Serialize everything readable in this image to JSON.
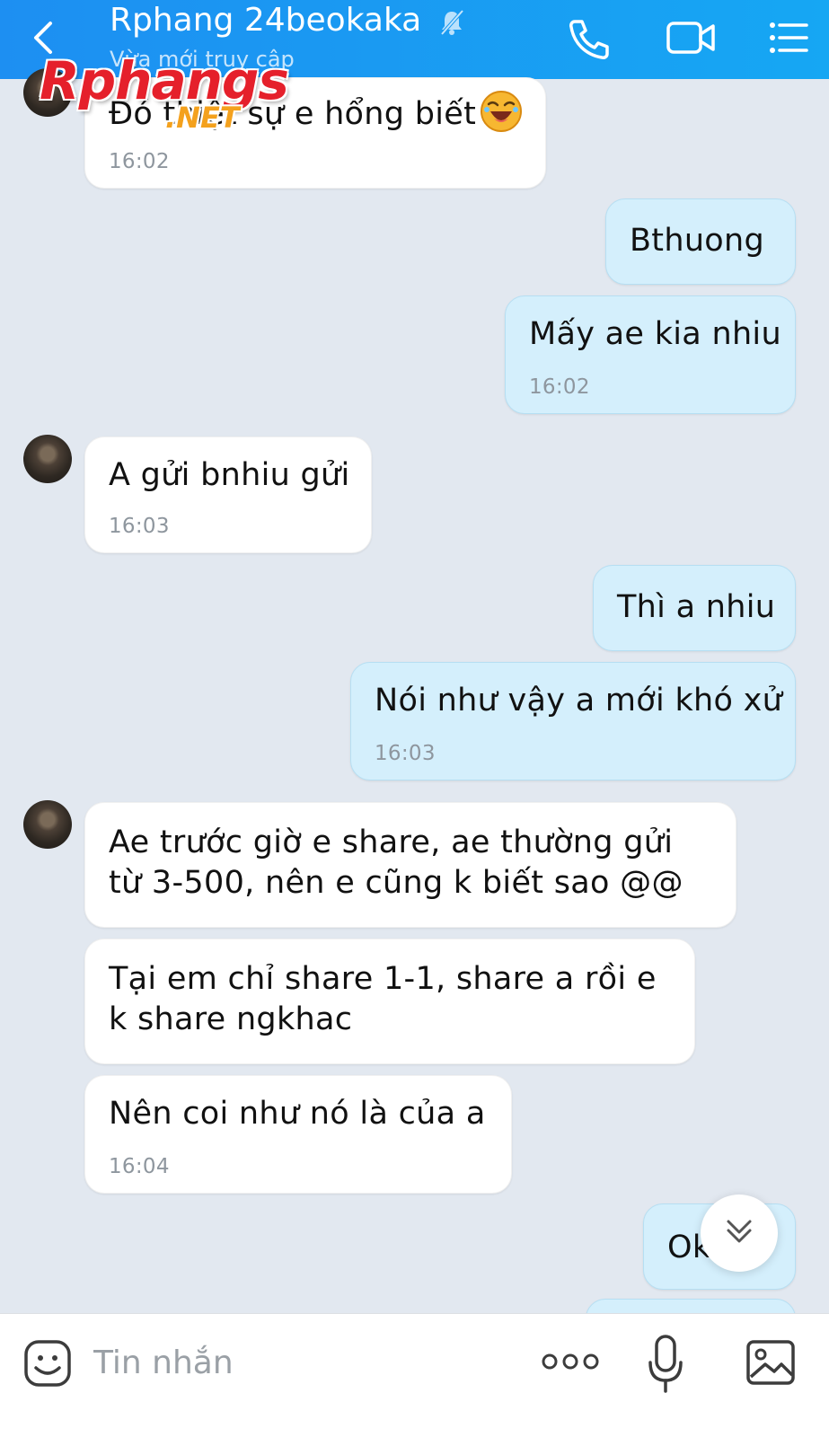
{
  "header": {
    "title": "Rphang 24beokaka",
    "status": "Vừa mới truy cập",
    "icons": [
      "back-icon",
      "mute-icon",
      "phone-icon",
      "video-icon",
      "menu-icon"
    ]
  },
  "watermark": {
    "main": "Rphangs",
    "sub": ".NET"
  },
  "messages": [
    {
      "from": "contact",
      "text": "Đó thiệt sự e hổng biết",
      "emoji": "laughing-emoji",
      "time": "16:02"
    },
    {
      "from": "me",
      "text": "Bthuong",
      "time": ""
    },
    {
      "from": "me",
      "text": "Mấy ae kia nhiu",
      "time": "16:02"
    },
    {
      "from": "contact",
      "text": "A gửi bnhiu gửi",
      "time": "16:03"
    },
    {
      "from": "me",
      "text": "Thì a nhiu",
      "time": ""
    },
    {
      "from": "me",
      "text": "Nói như vậy a mới khó xử",
      "time": "16:03"
    },
    {
      "from": "contact",
      "text": "Ae trước giờ e share, ae thường gửi từ 3-500, nên e cũng k biết sao @@",
      "time": ""
    },
    {
      "from": "contact",
      "text": "Tại em chỉ share 1-1, share a rồi e k share ngkhac",
      "time": ""
    },
    {
      "from": "contact",
      "text": "Nên coi như nó là của a",
      "time": "16:04"
    },
    {
      "from": "me",
      "text": "Ok",
      "time": ""
    }
  ],
  "composer": {
    "placeholder": "Tin nhắn",
    "value": "",
    "icons": [
      "sticker-icon",
      "more-icon",
      "microphone-icon",
      "image-icon"
    ]
  },
  "colors": {
    "header_bg": "#1d8ff2",
    "chat_bg": "#e2e8f0",
    "outgoing_bubble": "#d4effc",
    "incoming_bubble": "#ffffff",
    "timestamp": "#8e969e"
  }
}
